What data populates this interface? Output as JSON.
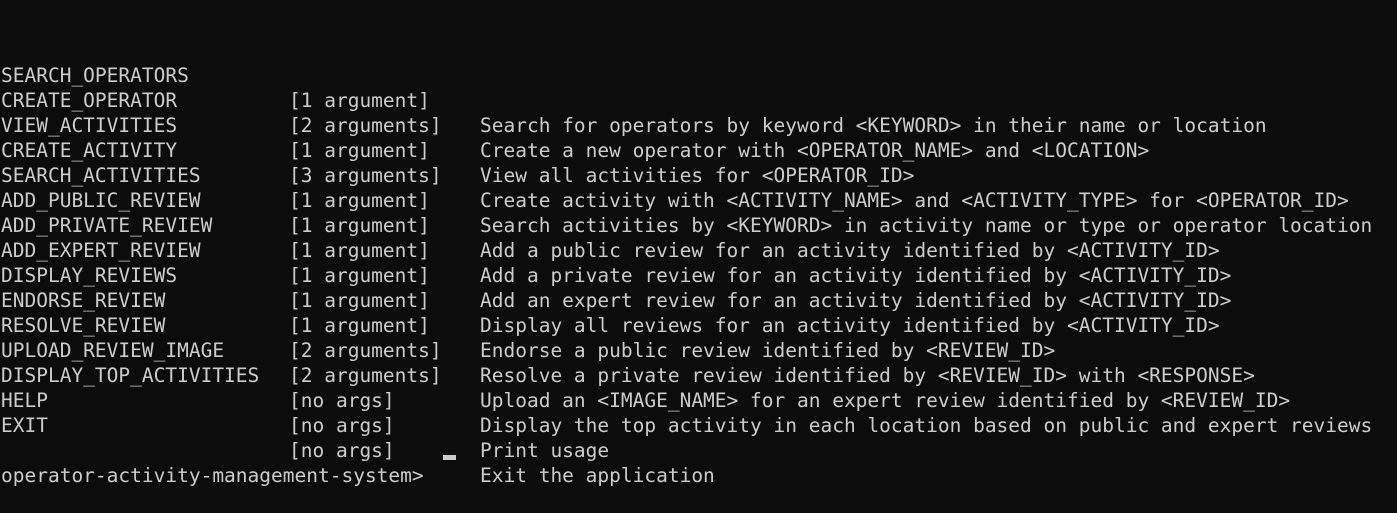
{
  "commands": [
    {
      "name": "SEARCH_OPERATORS",
      "args": "[1 argument]",
      "desc": "Search for operators by keyword <KEYWORD> in their name or location"
    },
    {
      "name": "CREATE_OPERATOR",
      "args": "[2 arguments]",
      "desc": "Create a new operator with <OPERATOR_NAME> and <LOCATION>"
    },
    {
      "name": "VIEW_ACTIVITIES",
      "args": "[1 argument]",
      "desc": "View all activities for <OPERATOR_ID>"
    },
    {
      "name": "CREATE_ACTIVITY",
      "args": "[3 arguments]",
      "desc": "Create activity with <ACTIVITY_NAME> and <ACTIVITY_TYPE> for <OPERATOR_ID>"
    },
    {
      "name": "SEARCH_ACTIVITIES",
      "args": "[1 argument]",
      "desc": "Search activities by <KEYWORD> in activity name or type or operator location"
    },
    {
      "name": "ADD_PUBLIC_REVIEW",
      "args": "[1 argument]",
      "desc": "Add a public review for an activity identified by <ACTIVITY_ID>"
    },
    {
      "name": "ADD_PRIVATE_REVIEW",
      "args": "[1 argument]",
      "desc": "Add a private review for an activity identified by <ACTIVITY_ID>"
    },
    {
      "name": "ADD_EXPERT_REVIEW",
      "args": "[1 argument]",
      "desc": "Add an expert review for an activity identified by <ACTIVITY_ID>"
    },
    {
      "name": "DISPLAY_REVIEWS",
      "args": "[1 argument]",
      "desc": "Display all reviews for an activity identified by <ACTIVITY_ID>"
    },
    {
      "name": "ENDORSE_REVIEW",
      "args": "[1 argument]",
      "desc": "Endorse a public review identified by <REVIEW_ID>"
    },
    {
      "name": "RESOLVE_REVIEW",
      "args": "[2 arguments]",
      "desc": "Resolve a private review identified by <REVIEW_ID> with <RESPONSE>"
    },
    {
      "name": "UPLOAD_REVIEW_IMAGE",
      "args": "[2 arguments]",
      "desc": "Upload an <IMAGE_NAME> for an expert review identified by <REVIEW_ID>"
    },
    {
      "name": "DISPLAY_TOP_ACTIVITIES",
      "args": "[no args]",
      "desc": "Display the top activity in each location based on public and expert reviews"
    },
    {
      "name": "HELP",
      "args": "[no args]",
      "desc": "Print usage"
    },
    {
      "name": "EXIT",
      "args": "[no args]",
      "desc": "Exit the application"
    }
  ],
  "prompt": "operator-activity-management-system>",
  "colors": {
    "background": "#0c0c0c",
    "text": "#cccccc"
  }
}
